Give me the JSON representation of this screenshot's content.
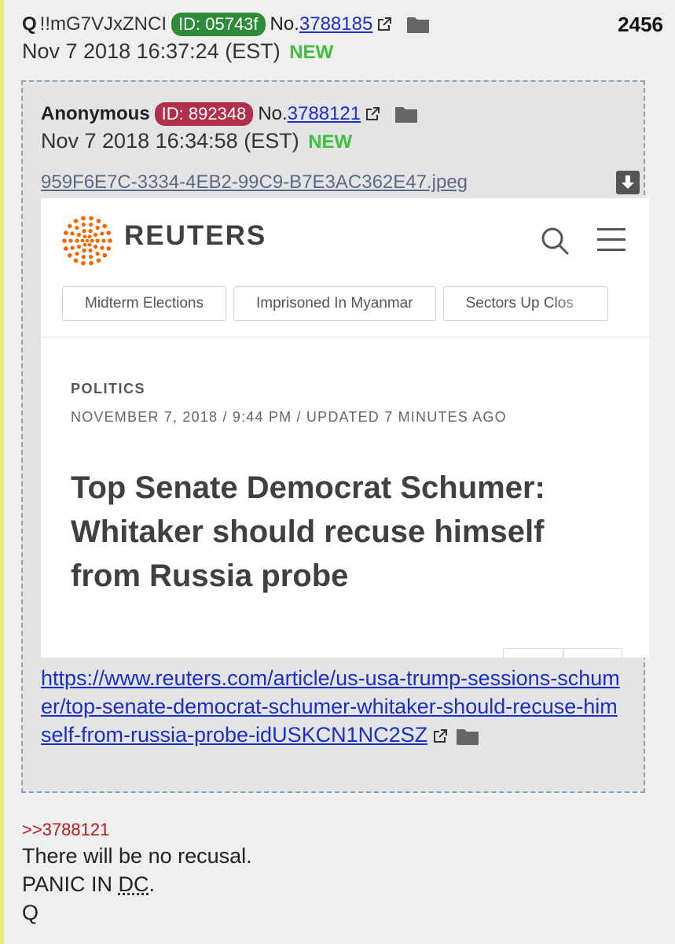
{
  "post": {
    "name": "Q",
    "tripcode": "!!mG7VJxZNCI",
    "id_badge": "ID: 05743f",
    "no_label": "No.",
    "number": "3788185",
    "count": "2456",
    "date": "Nov 7 2018 16:37:24 (EST)",
    "new_label": "NEW"
  },
  "quoted": {
    "name": "Anonymous",
    "id_badge": "ID: 892348",
    "no_label": "No.",
    "number": "3788121",
    "date": "Nov 7 2018 16:34:58 (EST)",
    "new_label": "NEW",
    "filename": "959F6E7C-3334-4EB2-99C9-B7E3AC362E47.jpeg",
    "url": "https://www.reuters.com/article/us-usa-trump-sessions-schumer/top-senate-democrat-schumer-whitaker-should-recuse-himself-from-russia-probe-idUSKCN1NC2SZ"
  },
  "screenshot": {
    "brand": "REUTERS",
    "tabs": [
      "Midterm Elections",
      "Imprisoned In Myanmar",
      "Sectors Up Clos"
    ],
    "section": "POLITICS",
    "dateline": "NOVEMBER 7, 2018 / 9:44 PM / UPDATED 7 MINUTES AGO",
    "headline": "Top Senate Democrat Schumer: Whitaker should recuse himself from Russia probe",
    "brand_color": "#fa6400"
  },
  "reply": {
    "backlink": ">>3788121",
    "line1": "There will be no recusal.",
    "line2_prefix": "PANIC IN ",
    "line2_abbr": "DC",
    "line2_suffix": ".",
    "line3": "Q"
  },
  "icons": {
    "external": "external-link-icon",
    "folder": "folder-icon",
    "download": "download-icon",
    "search": "search-icon",
    "menu": "hamburger-menu-icon"
  }
}
